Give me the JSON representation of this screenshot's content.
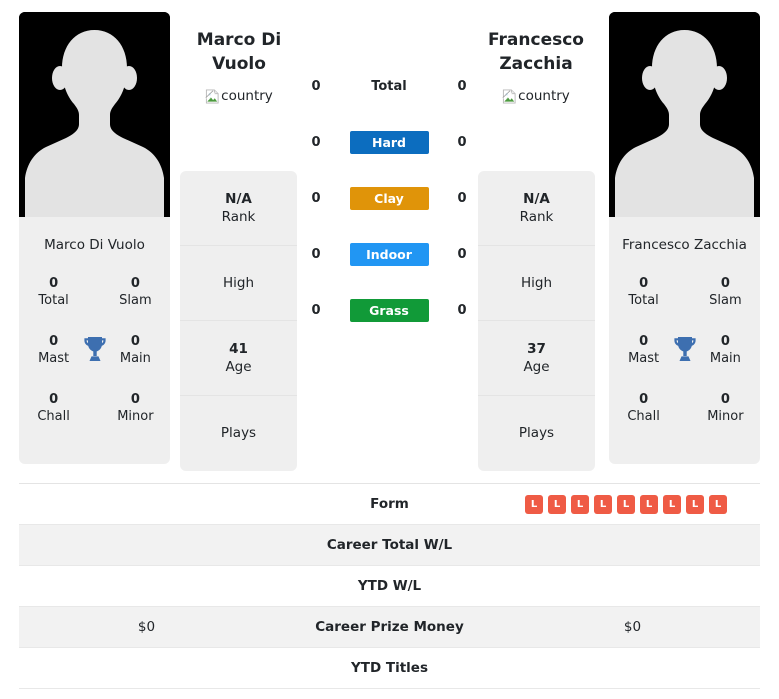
{
  "players": {
    "left": {
      "name": "Marco Di Vuolo",
      "display_name_line1": "Marco Di",
      "display_name_line2": "Vuolo",
      "country_alt": "country",
      "photo_caption": "Marco Di Vuolo",
      "titles": [
        {
          "value": "0",
          "label": "Total"
        },
        {
          "value": "0",
          "label": "Slam"
        },
        {
          "value": "0",
          "label": "Mast"
        },
        {
          "value": "0",
          "label": "Main"
        },
        {
          "value": "0",
          "label": "Chall"
        },
        {
          "value": "0",
          "label": "Minor"
        }
      ],
      "info": [
        {
          "value": "N/A",
          "label": "Rank"
        },
        {
          "value": "",
          "label": "High"
        },
        {
          "value": "41",
          "label": "Age"
        },
        {
          "value": "",
          "label": "Plays"
        }
      ]
    },
    "right": {
      "name": "Francesco Zacchia",
      "display_name_line1": "Francesco",
      "display_name_line2": "Zacchia",
      "country_alt": "country",
      "photo_caption": "Francesco Zacchia",
      "titles": [
        {
          "value": "0",
          "label": "Total"
        },
        {
          "value": "0",
          "label": "Slam"
        },
        {
          "value": "0",
          "label": "Mast"
        },
        {
          "value": "0",
          "label": "Main"
        },
        {
          "value": "0",
          "label": "Chall"
        },
        {
          "value": "0",
          "label": "Minor"
        }
      ],
      "info": [
        {
          "value": "N/A",
          "label": "Rank"
        },
        {
          "value": "",
          "label": "High"
        },
        {
          "value": "37",
          "label": "Age"
        },
        {
          "value": "",
          "label": "Plays"
        }
      ]
    }
  },
  "surfaces": [
    {
      "label": "Total",
      "left": "0",
      "right": "0",
      "color": "none",
      "style": "plain"
    },
    {
      "label": "Hard",
      "left": "0",
      "right": "0",
      "color": "#0c6dbf",
      "style": "badge"
    },
    {
      "label": "Clay",
      "left": "0",
      "right": "0",
      "color": "#e09409",
      "style": "badge"
    },
    {
      "label": "Indoor",
      "left": "0",
      "right": "0",
      "color": "#2196f3",
      "style": "badge"
    },
    {
      "label": "Grass",
      "left": "0",
      "right": "0",
      "color": "#119a38",
      "style": "badge"
    }
  ],
  "stats_table": {
    "form_badge_color": "#ef5b45",
    "rows": [
      {
        "label": "Form",
        "left": "",
        "right": "",
        "type": "form",
        "form_left": [],
        "form_right": [
          "L",
          "L",
          "L",
          "L",
          "L",
          "L",
          "L",
          "L",
          "L"
        ]
      },
      {
        "label": "Career Total W/L",
        "left": "",
        "right": "",
        "type": "text"
      },
      {
        "label": "YTD W/L",
        "left": "",
        "right": "",
        "type": "text"
      },
      {
        "label": "Career Prize Money",
        "left": "$0",
        "right": "$0",
        "type": "text"
      },
      {
        "label": "YTD Titles",
        "left": "",
        "right": "",
        "type": "text"
      }
    ]
  }
}
